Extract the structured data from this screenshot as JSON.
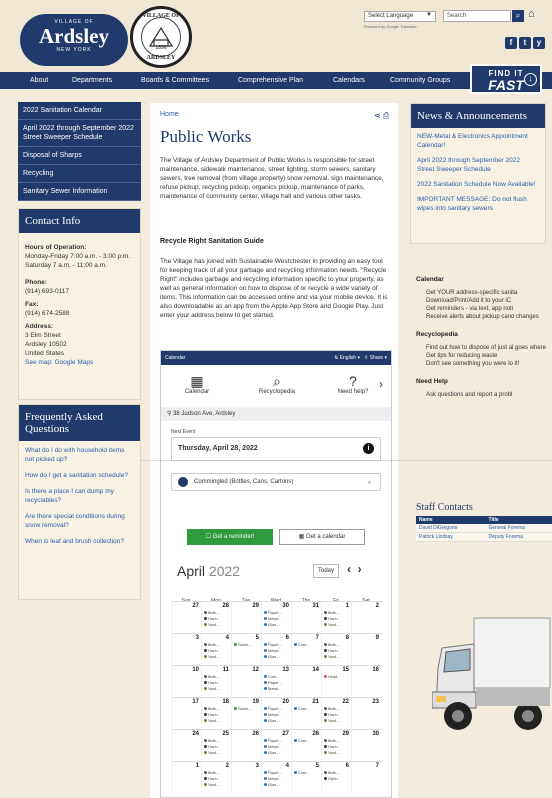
{
  "brand": {
    "top": "VILLAGE OF",
    "name": "Ardsley",
    "sub": "NEW YORK",
    "seal_top": "VILLAGE OF",
    "seal_year": "1896",
    "seal_bottom": "ARDSLEY"
  },
  "header": {
    "language": "Select Language",
    "powered": "Powered by Google Translate",
    "search_placeholder": "Search",
    "social": [
      "f",
      "t",
      "y"
    ]
  },
  "nav": [
    "About",
    "Departments",
    "Boards & Committees",
    "Comprehensive Plan",
    "Calendars",
    "Community Groups"
  ],
  "findit": {
    "line1": "FIND IT",
    "line2": "FAST"
  },
  "left_menu": [
    "2022 Sanitation Calendar",
    "April 2022 through September 2022 Street Sweeper Schedule",
    "Disposal of Sharps",
    "Recycling",
    "Sanitary Sewer Information"
  ],
  "contact": {
    "title": "Contact Info",
    "hours_label": "Hours of Operation:",
    "hours1": "Monday-Friday 7:00 a.m. - 3:00 p.m.",
    "hours2": "Saturday 7 a.m. - 11:00 a.m.",
    "phone_label": "Phone:",
    "phone": "(914) 693-0117",
    "fax_label": "Fax:",
    "fax": "(914) 674-2588",
    "address_label": "Address:",
    "addr1": "3 Elm Street",
    "addr2": "Ardsley 10502",
    "addr3": "United States",
    "map": "See map: Google Maps"
  },
  "faq": {
    "title": "Frequently Asked Questions",
    "items": [
      "What do I do with household items not picked up?",
      "How do I get a sanitation schedule?",
      "Is there a place I can dump my recyclables?",
      "Are there special conditions during snow removal?",
      "When is leaf and brush collection?"
    ]
  },
  "main": {
    "breadcrumb": "Home",
    "title": "Public Works",
    "intro": "The Village of Ardsley Department of Public Works is responsible for street maintenance, sidewalk maintenance, street lighting, storm sewers, sanitary sewers, tree removal (from village property) snow removal, sign maintenance, refuse pickup, recycling pickup, organics pickup, maintenance of parks, maintenance of community center, village hall and various other tasks.",
    "subhead": "Recycle Right Sanitation Guide",
    "body": "The Village has joined with Sustainable Westchester in providing an easy tool for keeping track of all your garbage and recycling information needs. \"Recycle Right\" includes garbage and recycling information specific to your property, as well as general information on how to dispose of or recycle a wide variety of items. This information can be accessed online and via your mobile device. It is also downloadable as an app from the Apple App Store and Google Play. Just enter your address below to get started."
  },
  "widget": {
    "bar": "Calendar",
    "english": "English",
    "share": "Share",
    "tabs": [
      "Calendar",
      "Recyclopedia",
      "Need help?"
    ],
    "address": "38 Judson Ave, Ardsley",
    "next_label": "Next Event",
    "next_date": "Thursday, April 28, 2022",
    "collection": "Commingled (Bottles, Cans, Cartons)",
    "reminder": "Get a reminder!",
    "get_calendar": "Get a calendar",
    "month": "April",
    "year": "2022",
    "today": "Today",
    "dow": [
      "Sun",
      "Mon",
      "Tue",
      "Wed",
      "Thu",
      "Fri",
      "Sat"
    ]
  },
  "calendar_weeks": [
    [
      {
        "n": "27"
      },
      {
        "n": "28",
        "e": [
          "Bulk...",
          "Garb...",
          "Yard..."
        ]
      },
      {
        "n": "29"
      },
      {
        "n": "30",
        "e": [
          "Paper...",
          "Metal...",
          "Glas..."
        ]
      },
      {
        "n": "31"
      },
      {
        "n": "1",
        "e": [
          "Bulk...",
          "Garb...",
          "Yard..."
        ]
      },
      {
        "n": "2"
      }
    ],
    [
      {
        "n": "3"
      },
      {
        "n": "4",
        "e": [
          "Bulk...",
          "Garb...",
          "Yard..."
        ]
      },
      {
        "n": "5",
        "e": [
          "Swee..."
        ]
      },
      {
        "n": "6",
        "e": [
          "Paper...",
          "Metal...",
          "Glas..."
        ]
      },
      {
        "n": "7",
        "e": [
          "Com..."
        ]
      },
      {
        "n": "8",
        "e": [
          "Bulk...",
          "Garb...",
          "Yard..."
        ]
      },
      {
        "n": "9"
      }
    ],
    [
      {
        "n": "10"
      },
      {
        "n": "11",
        "e": [
          "Bulk...",
          "Garb...",
          "Yard..."
        ]
      },
      {
        "n": "12"
      },
      {
        "n": "13",
        "e": [
          "Com...",
          "Paper...",
          "Metal..."
        ]
      },
      {
        "n": "14"
      },
      {
        "n": "15",
        "e": [
          "Holid..."
        ]
      },
      {
        "n": "16"
      }
    ],
    [
      {
        "n": "17"
      },
      {
        "n": "18",
        "e": [
          "Bulk...",
          "Garb...",
          "Yard..."
        ]
      },
      {
        "n": "19",
        "e": [
          "Swee..."
        ]
      },
      {
        "n": "20",
        "e": [
          "Paper...",
          "Metal...",
          "Glas..."
        ]
      },
      {
        "n": "21",
        "e": [
          "Com..."
        ]
      },
      {
        "n": "22",
        "e": [
          "Bulk...",
          "Garb...",
          "Yard..."
        ]
      },
      {
        "n": "23"
      }
    ],
    [
      {
        "n": "24"
      },
      {
        "n": "25",
        "e": [
          "Bulk...",
          "Garb...",
          "Yard..."
        ]
      },
      {
        "n": "26"
      },
      {
        "n": "27",
        "e": [
          "Paper...",
          "Metal...",
          "Glas..."
        ]
      },
      {
        "n": "28",
        "e": [
          "Com..."
        ]
      },
      {
        "n": "29",
        "e": [
          "Bulk...",
          "Garb...",
          "Yard..."
        ]
      },
      {
        "n": "30"
      }
    ],
    [
      {
        "n": "1"
      },
      {
        "n": "2",
        "e": [
          "Bulk...",
          "Garb...",
          "Yard..."
        ]
      },
      {
        "n": "3"
      },
      {
        "n": "4",
        "e": [
          "Paper...",
          "Metal...",
          "Glas..."
        ]
      },
      {
        "n": "5",
        "e": [
          "Com..."
        ]
      },
      {
        "n": "6",
        "e": [
          "Bulk...",
          "Garb..."
        ]
      },
      {
        "n": "7"
      }
    ]
  ],
  "event_colors": {
    "Bulk...": "#555555",
    "Garb...": "#333333",
    "Yard...": "#8a6d3b",
    "Paper...": "#2a7ab8",
    "Metal...": "#2a7ab8",
    "Glas...": "#2a7ab8",
    "Com...": "#2a7ab8",
    "Swee...": "#2e9b3e",
    "Holid...": "#d9534f"
  },
  "news": {
    "title": "News & Announcements",
    "items": [
      "NEW-Metal & Electronics Appointment Calendar!",
      "April 2022 through September 2022 Street Sweeper Schedule",
      "2022 Sanitation Schedule Now Available!",
      "IMPORTANT MESSAGE: Do not flush wipes into sanitary sewers"
    ]
  },
  "right_sections": [
    {
      "head": "Calendar",
      "items": [
        "Get YOUR address-specific sanita",
        "Download/Print/Add it to your iC",
        "Get reminders - via text, app noti",
        "Receive alerts about pickup cano changes"
      ]
    },
    {
      "head": "Recyclopedia",
      "items": [
        "Find out how to dispose of just al goes where",
        "Get tips for reducing waste",
        "Don't see something you were lo it!"
      ]
    },
    {
      "head": "Need Help",
      "items": [
        "Ask questions and report a probl"
      ]
    }
  ],
  "staff": {
    "title": "Staff Contacts",
    "cols": [
      "Name",
      "Title"
    ],
    "rows": [
      [
        "David DiGregorio",
        "General Forema"
      ],
      [
        "Patrick Lindsay",
        "Deputy Forema"
      ]
    ]
  }
}
